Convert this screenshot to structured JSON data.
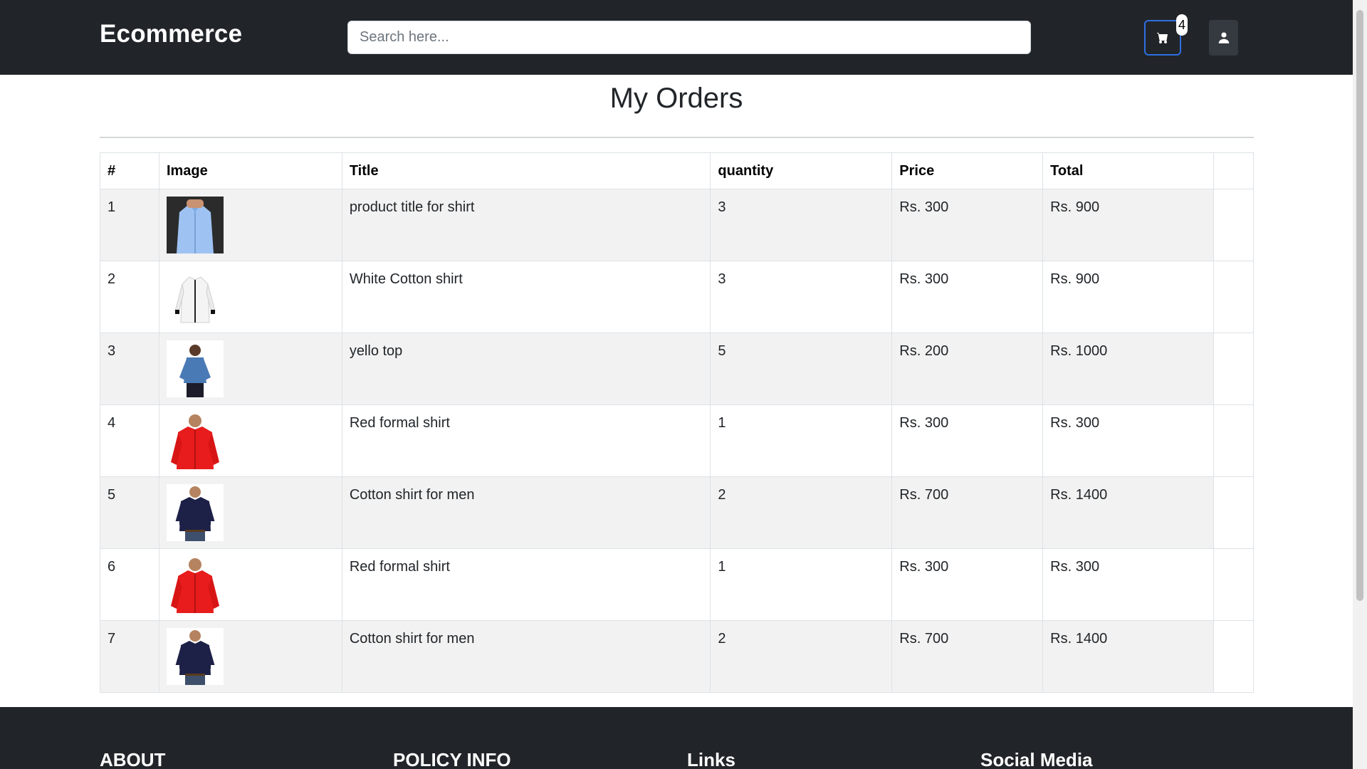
{
  "header": {
    "brand": "Ecommerce",
    "search_placeholder": "Search here...",
    "cart_count": "4",
    "cart_icon": "cart-icon",
    "user_icon": "user-icon"
  },
  "page": {
    "title": "My Orders"
  },
  "table": {
    "headers": [
      "#",
      "Image",
      "Title",
      "quantity",
      "Price",
      "Total"
    ],
    "rows": [
      {
        "num": "1",
        "image": "light-blue-shirt",
        "title": "product title for shirt",
        "quantity": "3",
        "price": "Rs. 300",
        "total": "Rs. 900"
      },
      {
        "num": "2",
        "image": "white-cotton-shirt",
        "title": "White Cotton shirt",
        "quantity": "3",
        "price": "Rs. 300",
        "total": "Rs. 900"
      },
      {
        "num": "3",
        "image": "blue-top-woman",
        "title": "yello top",
        "quantity": "5",
        "price": "Rs. 200",
        "total": "Rs. 1000"
      },
      {
        "num": "4",
        "image": "red-formal-shirt",
        "title": "Red formal shirt",
        "quantity": "1",
        "price": "Rs. 300",
        "total": "Rs. 300"
      },
      {
        "num": "5",
        "image": "navy-cotton-shirt",
        "title": "Cotton shirt for men",
        "quantity": "2",
        "price": "Rs. 700",
        "total": "Rs. 1400"
      },
      {
        "num": "6",
        "image": "red-formal-shirt",
        "title": "Red formal shirt",
        "quantity": "1",
        "price": "Rs. 300",
        "total": "Rs. 300"
      },
      {
        "num": "7",
        "image": "navy-cotton-shirt",
        "title": "Cotton shirt for men",
        "quantity": "2",
        "price": "Rs. 700",
        "total": "Rs. 1400"
      }
    ]
  },
  "footer": {
    "sections": [
      "ABOUT",
      "POLICY INFO",
      "Links",
      "Social Media"
    ]
  },
  "colors": {
    "navbar": "#212529",
    "cart_border": "#2f6fe0",
    "stripe": "#f2f2f2"
  }
}
